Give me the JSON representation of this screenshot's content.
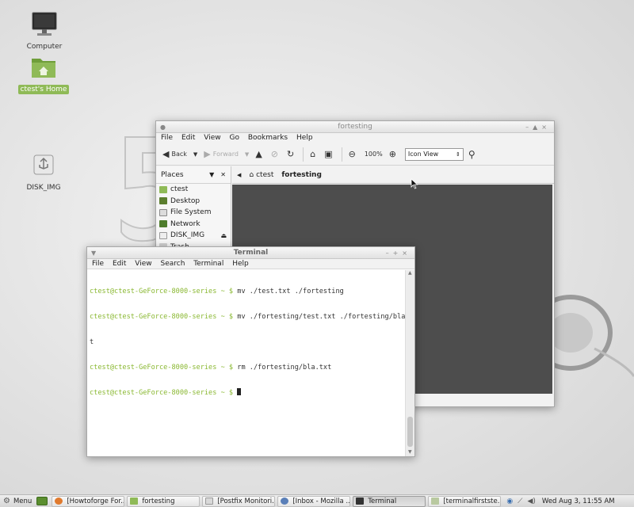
{
  "desktop": {
    "icons": [
      {
        "label": "Computer",
        "icon": "monitor-icon"
      },
      {
        "label": "ctest's Home",
        "icon": "home-folder-icon",
        "selected": true
      },
      {
        "label": "DISK_IMG",
        "icon": "usb-drive-icon"
      }
    ]
  },
  "file_manager": {
    "title": "fortesting",
    "menu": [
      "File",
      "Edit",
      "View",
      "Go",
      "Bookmarks",
      "Help"
    ],
    "toolbar": {
      "back": "Back",
      "forward": "Forward",
      "zoom": "100%",
      "view_mode": "Icon View"
    },
    "sidebar": {
      "header": "Places",
      "items": [
        {
          "label": "ctest",
          "icon": "home-icon"
        },
        {
          "label": "Desktop",
          "icon": "desktop-icon"
        },
        {
          "label": "File System",
          "icon": "drive-icon"
        },
        {
          "label": "Network",
          "icon": "network-icon"
        },
        {
          "label": "DISK_IMG",
          "icon": "removable-drive-icon"
        },
        {
          "label": "Trash",
          "icon": "trash-icon"
        }
      ]
    },
    "path": [
      "ctest",
      "fortesting"
    ]
  },
  "terminal": {
    "title": "Terminal",
    "menu": [
      "File",
      "Edit",
      "View",
      "Search",
      "Terminal",
      "Help"
    ],
    "lines": [
      {
        "prompt": "ctest@ctest-GeForce-8000-series ~ $",
        "cmd": " mv ./test.txt ./fortesting"
      },
      {
        "prompt": "ctest@ctest-GeForce-8000-series ~ $",
        "cmd": " mv ./fortesting/test.txt ./fortesting/bla.tx"
      },
      {
        "prompt": "",
        "cmd": "t"
      },
      {
        "prompt": "ctest@ctest-GeForce-8000-series ~ $",
        "cmd": " rm ./fortesting/bla.txt"
      },
      {
        "prompt": "ctest@ctest-GeForce-8000-series ~ $",
        "cmd": " "
      }
    ]
  },
  "taskbar": {
    "menu_label": "Menu",
    "tasks": [
      {
        "label": "[Howtoforge For...",
        "icon": "firefox-icon",
        "color": "#e07a2e"
      },
      {
        "label": "fortesting",
        "icon": "folder-icon",
        "color": "#8fba57"
      },
      {
        "label": "[Postfix Monitori...",
        "icon": "document-icon",
        "color": "#d9d9d9"
      },
      {
        "label": "[Inbox - Mozilla ...",
        "icon": "thunderbird-icon",
        "color": "#5a7fb8"
      },
      {
        "label": "Terminal",
        "icon": "terminal-icon",
        "color": "#333333",
        "active": true
      },
      {
        "label": "[terminalfirstste...",
        "icon": "image-icon",
        "color": "#b9c9a0"
      }
    ],
    "clock": "Wed Aug  3, 11:55 AM"
  },
  "colors": {
    "accent_green": "#8fba57",
    "prompt_green": "#8ab832",
    "fm_content_bg": "#4d4d4d"
  }
}
